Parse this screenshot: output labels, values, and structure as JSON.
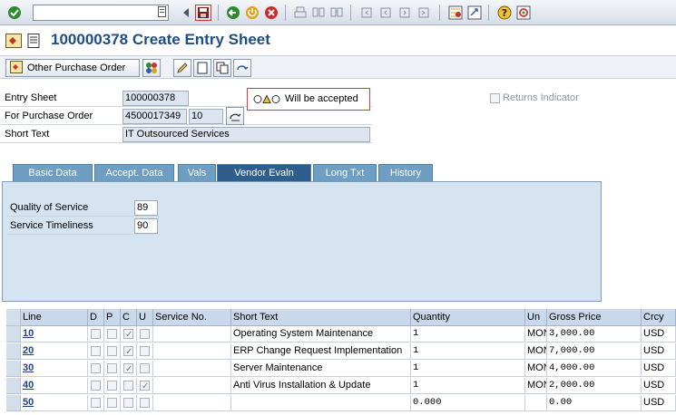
{
  "toolbar": {
    "command_value": "",
    "icons": [
      "enter-icon",
      "back-icon",
      "save-icon",
      "back-arrow-icon",
      "exit-icon",
      "cancel-icon",
      "print-icon",
      "find-icon",
      "find-next-icon",
      "first-page-icon",
      "prev-page-icon",
      "next-page-icon",
      "last-page-icon",
      "new-session-icon",
      "shortcut-icon",
      "help-icon",
      "customize-icon"
    ]
  },
  "header": {
    "title": "100000378 Create Entry Sheet"
  },
  "app_toolbar": {
    "other_po_label": "Other Purchase Order"
  },
  "fields": {
    "entry_sheet_label": "Entry Sheet",
    "entry_sheet_value": "100000378",
    "po_label": "For Purchase Order",
    "po_value": "4500017349",
    "po_item": "10",
    "short_text_label": "Short Text",
    "short_text_value": "IT Outsourced Services",
    "status_text": "Will be accepted",
    "returns_label": "Returns Indicator"
  },
  "tabs": [
    {
      "label": "Basic Data",
      "active": false
    },
    {
      "label": "Accept. Data",
      "active": false
    },
    {
      "label": "Vals",
      "active": false
    },
    {
      "label": "Vendor Evaln",
      "active": true
    },
    {
      "label": "Long Txt",
      "active": false
    },
    {
      "label": "History",
      "active": false
    }
  ],
  "vendor_eval": {
    "quality_label": "Quality of Service",
    "quality_value": "89",
    "timeliness_label": "Service Timeliness",
    "timeliness_value": "90"
  },
  "table": {
    "columns": [
      "Line",
      "D",
      "P",
      "C",
      "U",
      "Service No.",
      "Short Text",
      "Quantity",
      "Un",
      "Gross Price",
      "Crcy"
    ],
    "rows": [
      {
        "line": "10",
        "d": false,
        "p": false,
        "c": true,
        "u": false,
        "service_no": "",
        "short_text": "Operating System Maintenance",
        "quantity": "1",
        "un": "MON",
        "gross_price": "3,000.00",
        "crcy": "USD"
      },
      {
        "line": "20",
        "d": false,
        "p": false,
        "c": true,
        "u": false,
        "service_no": "",
        "short_text": "ERP Change Request Implementation",
        "quantity": "1",
        "un": "MON",
        "gross_price": "7,000.00",
        "crcy": "USD"
      },
      {
        "line": "30",
        "d": false,
        "p": false,
        "c": true,
        "u": false,
        "service_no": "",
        "short_text": "Server Maintenance",
        "quantity": "1",
        "un": "MON",
        "gross_price": "4,000.00",
        "crcy": "USD"
      },
      {
        "line": "40",
        "d": false,
        "p": false,
        "c": false,
        "u": true,
        "service_no": "",
        "short_text": "Anti Virus Installation & Update",
        "quantity": "1",
        "un": "MON",
        "gross_price": "2,000.00",
        "crcy": "USD"
      },
      {
        "line": "50",
        "d": false,
        "p": false,
        "c": false,
        "u": false,
        "service_no": "",
        "short_text": "",
        "quantity": "0.000",
        "un": "",
        "gross_price": "0.00",
        "crcy": "USD"
      }
    ]
  },
  "colors": {
    "title": "#1d4e89",
    "tab": "#6e9ec2",
    "tab_active": "#2e5e8c",
    "panel": "#d6e4f2",
    "status_border": "#e03a3a"
  }
}
